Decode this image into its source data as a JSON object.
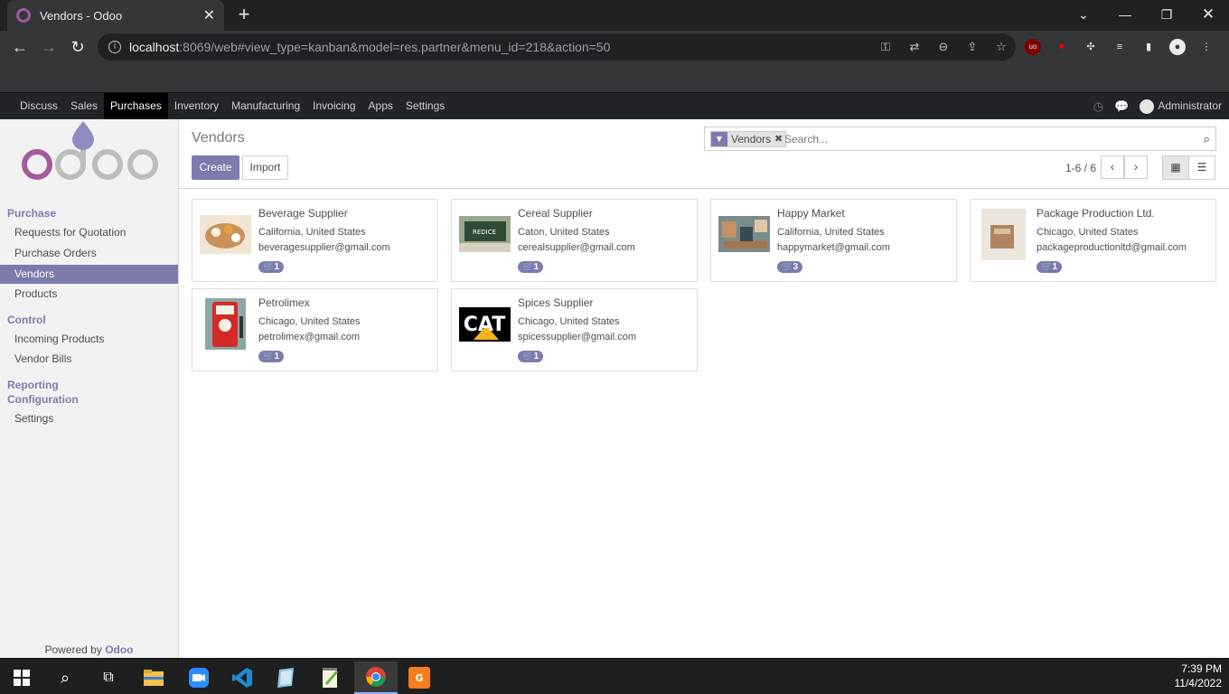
{
  "browser": {
    "tab_title": "Vendors - Odoo",
    "url_host": "localhost",
    "url_rest": ":8069/web#view_type=kanban&model=res.partner&menu_id=218&action=50"
  },
  "topnav": {
    "items": [
      "Discuss",
      "Sales",
      "Purchases",
      "Inventory",
      "Manufacturing",
      "Invoicing",
      "Apps",
      "Settings"
    ],
    "active": "Purchases",
    "user": "Administrator"
  },
  "sidebar": {
    "sections": [
      {
        "title": "Purchase",
        "items": [
          "Requests for Quotation",
          "Purchase Orders",
          "Vendors",
          "Products"
        ]
      },
      {
        "title": "Control",
        "items": [
          "Incoming Products",
          "Vendor Bills"
        ]
      },
      {
        "title": "Reporting",
        "items": []
      },
      {
        "title": "Configuration",
        "items": [
          "Settings"
        ]
      }
    ],
    "active_item": "Vendors",
    "powered_prefix": "Powered by",
    "powered_brand": "Odoo"
  },
  "control_panel": {
    "breadcrumb": "Vendors",
    "create_label": "Create",
    "import_label": "Import",
    "facet_value": "Vendors",
    "search_placeholder": "Search...",
    "pager": "1-6 / 6"
  },
  "vendors": [
    {
      "name": "Beverage Supplier",
      "location": "California, United States",
      "email": "beveragesupplier@gmail.com",
      "count": "1"
    },
    {
      "name": "Cereal Supplier",
      "location": "Caton, United States",
      "email": "cerealsupplier@gmail.com",
      "count": "1"
    },
    {
      "name": "Happy Market",
      "location": "California, United States",
      "email": "happymarket@gmail.com",
      "count": "3"
    },
    {
      "name": "Package Production Ltd.",
      "location": "Chicago, United States",
      "email": "packageproductionltd@gmail.com",
      "count": "1"
    },
    {
      "name": "Petrolimex",
      "location": "Chicago, United States",
      "email": "petrolimex@gmail.com",
      "count": "1"
    },
    {
      "name": "Spices Supplier",
      "location": "Chicago, United States",
      "email": "spicessupplier@gmail.com",
      "count": "1"
    }
  ],
  "taskbar": {
    "time": "7:39 PM",
    "date": "11/4/2022"
  },
  "colors": {
    "accent": "#7c7bad",
    "nav_bg": "#212529"
  }
}
